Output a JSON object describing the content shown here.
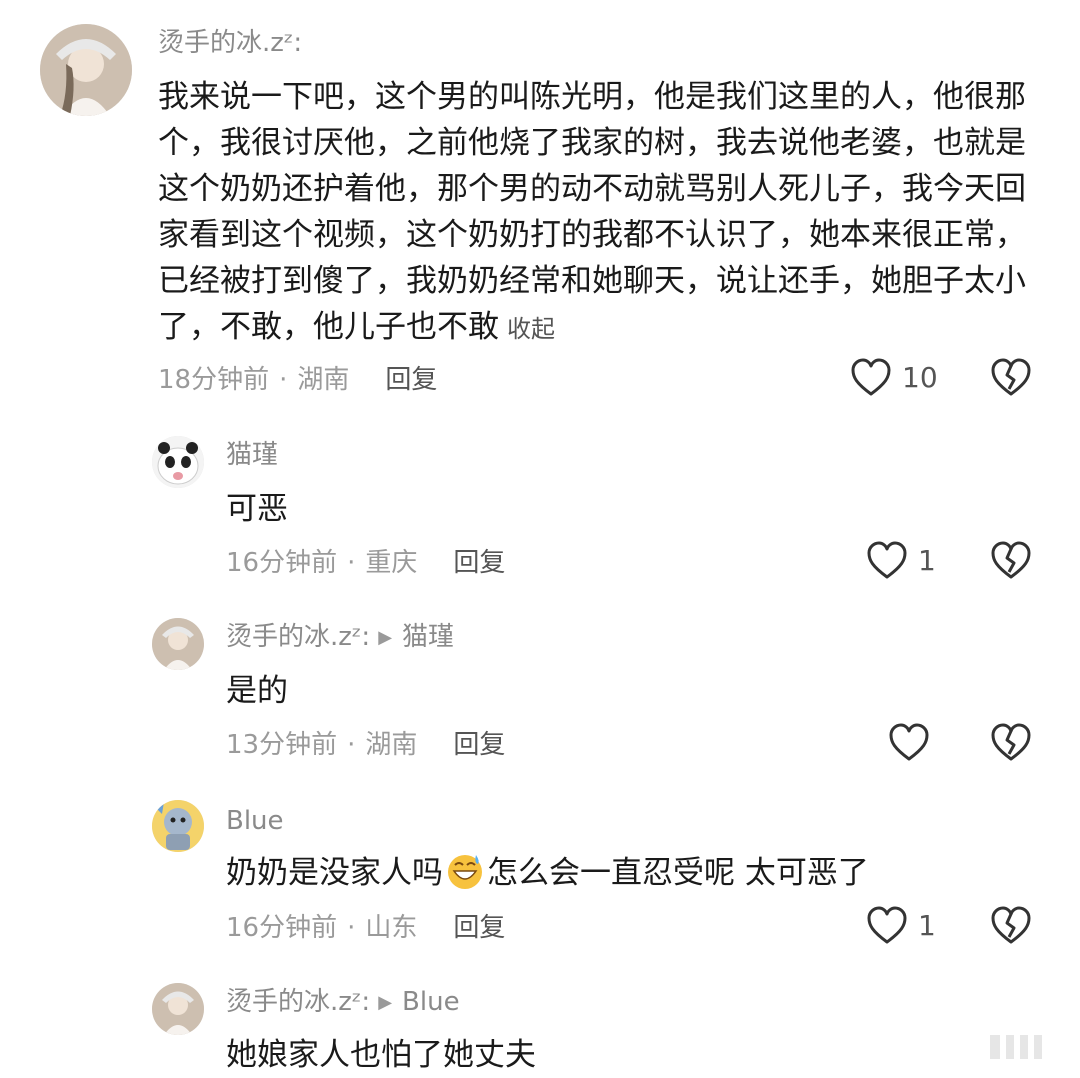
{
  "comments": [
    {
      "username": "烫手的冰.zᶻ:",
      "content": "我来说一下吧，这个男的叫陈光明，他是我们这里的人，他很那个，我很讨厌他，之前他烧了我家的树，我去说他老婆，也就是这个奶奶还护着他，那个男的动不动就骂别人死儿子，我今天回家看到这个视频，这个奶奶打的我都不认识了，她本来很正常，已经被打到傻了，我奶奶经常和她聊天，说让还手，她胆子太小了，不敢，他儿子也不敢",
      "fold_label": "收起",
      "time": "18分钟前",
      "location": "湖南",
      "reply_label": "回复",
      "like_count": "10"
    },
    {
      "username": "猫瑾",
      "content": "可恶",
      "time": "16分钟前",
      "location": "重庆",
      "reply_label": "回复",
      "like_count": "1"
    },
    {
      "username": "烫手的冰.zᶻ:",
      "reply_to": "猫瑾",
      "content": "是的",
      "time": "13分钟前",
      "location": "湖南",
      "reply_label": "回复",
      "like_count": ""
    },
    {
      "username": "Blue",
      "content_before": "奶奶是没家人吗",
      "content_after": "怎么会一直忍受呢 太可恶了",
      "emoji": "grinning-sweat-emoji",
      "time": "16分钟前",
      "location": "山东",
      "reply_label": "回复",
      "like_count": "1"
    },
    {
      "username": "烫手的冰.zᶻ:",
      "reply_to": "Blue",
      "content": "她娘家人也怕了她丈夫"
    }
  ],
  "icons": {
    "like": "heart-outline-icon",
    "dislike": "broken-heart-icon",
    "reply_arrow": "play-triangle-icon"
  },
  "colors": {
    "meta": "#9a9a9a",
    "text": "#1a1a1a",
    "icon": "#333333"
  }
}
